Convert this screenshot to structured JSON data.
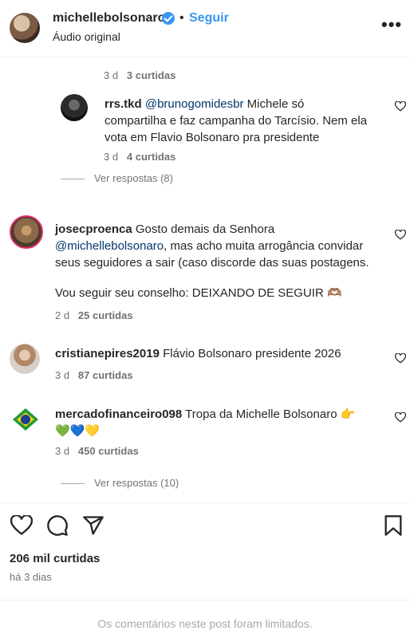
{
  "header": {
    "username": "michellebolsonaro",
    "separator": "•",
    "follow_label": "Seguir",
    "subtitle": "Áudio original",
    "more_label": "•••"
  },
  "comments": [
    {
      "time": "3 d",
      "likes": "3 curtidas"
    },
    {
      "username": "rrs.tkd",
      "mention": "@brunogomidesbr",
      "text_line1": "Michele só",
      "text_line2": "compartilha e faz campanha do Tarcísio. Nem ela",
      "text_line3": "vota em Flavio Bolsonaro pra presidente",
      "time": "3 d",
      "likes": "4 curtidas",
      "replies": "Ver respostas (8)"
    },
    {
      "username": "josecproenca",
      "text_line1": "Gosto demais da Senhora",
      "mention": "@michellebolsonaro",
      "text_line2": ", mas acho muita arrogância convidar",
      "text_line3": "seus seguidores a sair (caso discorde das suas postagens.",
      "text_line4": "Vou seguir seu conselho: DEIXANDO DE SEGUIR",
      "emoji": "🫶🏽",
      "time": "2 d",
      "likes": "25 curtidas"
    },
    {
      "username": "cristianepires2019",
      "text": "Flávio Bolsonaro presidente 2026",
      "time": "3 d",
      "likes": "87 curtidas"
    },
    {
      "username": "mercadofinanceiro098",
      "text": "Tropa da Michelle Bolsonaro",
      "emoji1": "👉",
      "emoji_line2": "💚💙💛",
      "time": "3 d",
      "likes": "450 curtidas",
      "replies": "Ver respostas (10)"
    }
  ],
  "post": {
    "likes": "206 mil curtidas",
    "date": "há 3 dias",
    "comments_limited": "Os comentários neste post foram limitados."
  },
  "colors": {
    "accent": "#3797f0",
    "mention": "#00376b",
    "muted": "#737373"
  }
}
